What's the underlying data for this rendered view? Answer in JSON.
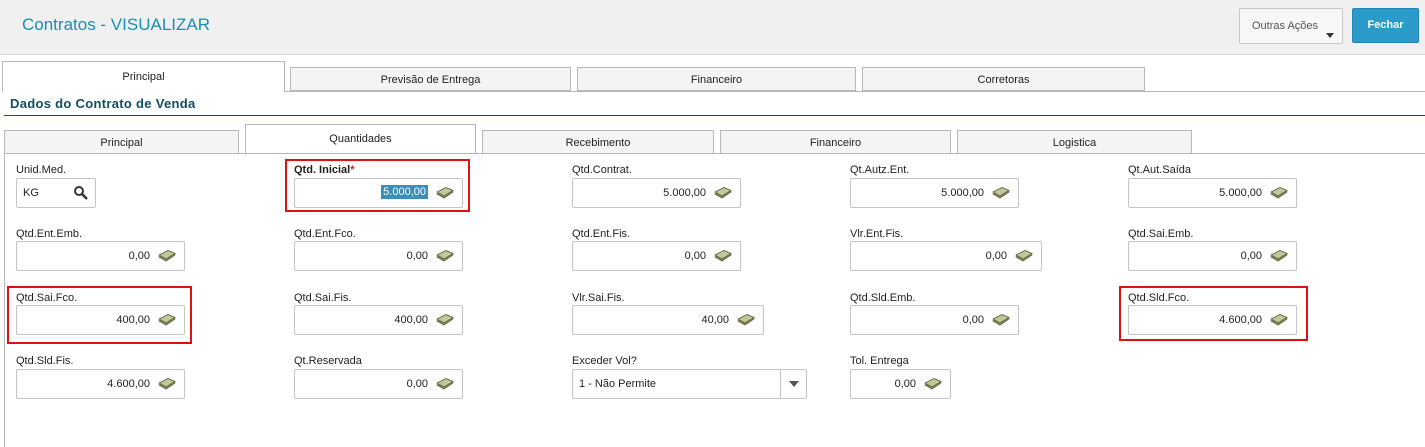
{
  "header": {
    "title": "Contratos - VISUALIZAR",
    "outras_acoes": "Outras Ações",
    "fechar": "Fechar"
  },
  "outer_tabs": [
    "Principal",
    "Previsão de Entrega",
    "Financeiro",
    "Corretoras"
  ],
  "section_title": "Dados do Contrato de Venda",
  "inner_tabs": [
    "Principal",
    "Quantidades",
    "Recebimento",
    "Financeiro",
    "Logistica"
  ],
  "fields": {
    "unid_med": {
      "label": "Unid.Med.",
      "value": "KG"
    },
    "qtd_inicial": {
      "label": "Qtd. Inicial",
      "required": "*",
      "value": "5.000,00"
    },
    "qtd_contrat": {
      "label": "Qtd.Contrat.",
      "value": "5.000,00"
    },
    "qt_autz_ent": {
      "label": "Qt.Autz.Ent.",
      "value": "5.000,00"
    },
    "qt_aut_saida": {
      "label": "Qt.Aut.Saída",
      "value": "5.000,00"
    },
    "qtd_ent_emb": {
      "label": "Qtd.Ent.Emb.",
      "value": "0,00"
    },
    "qtd_ent_fco": {
      "label": "Qtd.Ent.Fco.",
      "value": "0,00"
    },
    "qtd_ent_fis": {
      "label": "Qtd.Ent.Fis.",
      "value": "0,00"
    },
    "vlr_ent_fis": {
      "label": "Vlr.Ent.Fis.",
      "value": "0,00"
    },
    "qtd_sai_emb": {
      "label": "Qtd.Sai.Emb.",
      "value": "0,00"
    },
    "qtd_sai_fco": {
      "label": "Qtd.Sai.Fco.",
      "value": "400,00"
    },
    "qtd_sai_fis": {
      "label": "Qtd.Sai.Fis.",
      "value": "400,00"
    },
    "vlr_sai_fis": {
      "label": "Vlr.Sai.Fis.",
      "value": "40,00"
    },
    "qtd_sld_emb": {
      "label": "Qtd.Sld.Emb.",
      "value": "0,00"
    },
    "qtd_sld_fco": {
      "label": "Qtd.Sld.Fco.",
      "value": "4.600,00"
    },
    "qtd_sld_fis": {
      "label": "Qtd.Sld.Fis.",
      "value": "4.600,00"
    },
    "qt_reservada": {
      "label": "Qt.Reservada",
      "value": "0,00"
    },
    "exceder_vol": {
      "label": "Exceder Vol?",
      "value": "1 - Não Permite"
    },
    "tol_entrega": {
      "label": "Tol. Entrega",
      "value": "0,00"
    }
  },
  "colors": {
    "accent": "#2c9bc9",
    "title": "#1a8fb0",
    "section": "#0f4e64",
    "highlight": "#e01010"
  },
  "icons": {
    "money": "money-icon",
    "search": "search-icon"
  }
}
